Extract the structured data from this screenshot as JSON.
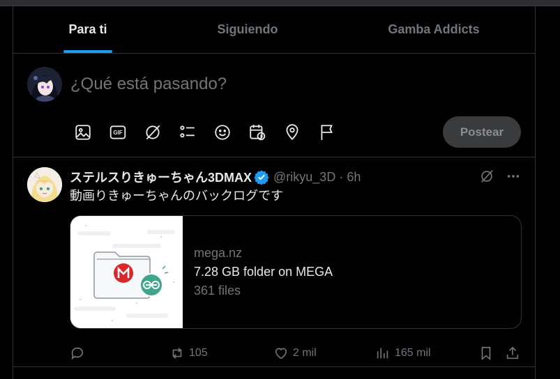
{
  "tabs": [
    {
      "label": "Para ti",
      "active": true
    },
    {
      "label": "Siguiendo",
      "active": false
    },
    {
      "label": "Gamba Addicts",
      "active": false
    }
  ],
  "composer": {
    "placeholder": "¿Qué está pasando?",
    "tools": [
      "image-icon",
      "gif-icon",
      "grok-icon",
      "poll-icon",
      "emoji-icon",
      "schedule-icon",
      "location-icon",
      "flag-icon"
    ],
    "gif_label": "GIF",
    "post_label": "Postear"
  },
  "tweet": {
    "display_name": "ステルスりきゅーちゃん3DMAX",
    "handle": "@rikyu_3D",
    "separator": "·",
    "time": "6h",
    "text": "動画りきゅーちゃんのバックログです",
    "card": {
      "domain": "mega.nz",
      "title": "7.28 GB folder on MEGA",
      "description": "361 files"
    },
    "actions": {
      "replies": "",
      "reposts": "105",
      "likes": "2 mil",
      "views": "165 mil"
    }
  },
  "colors": {
    "accent": "#1d9bf0",
    "background": "#000000",
    "text": "#e7e9ea",
    "muted": "#71767b",
    "border": "#2f3336",
    "mega_red": "#d9272e",
    "mega_green": "#3fa58c"
  }
}
